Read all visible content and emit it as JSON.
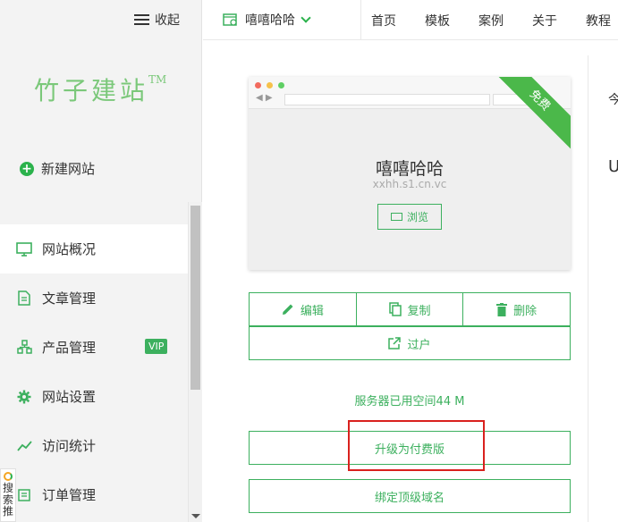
{
  "sidebar": {
    "collapse_label": "收起",
    "logo_text": "竹子建站",
    "logo_tm": "TM",
    "new_site_label": "新建网站",
    "items": [
      {
        "label": "网站概况",
        "icon": "monitor-icon",
        "active": true
      },
      {
        "label": "文章管理",
        "icon": "document-icon"
      },
      {
        "label": "产品管理",
        "icon": "product-icon",
        "badge": "VIP"
      },
      {
        "label": "网站设置",
        "icon": "gear-icon"
      },
      {
        "label": "访问统计",
        "icon": "line-chart-icon"
      },
      {
        "label": "订单管理",
        "icon": "cart-icon"
      }
    ],
    "search_float_label": "搜索推"
  },
  "topbar": {
    "site_name": "嘻嘻哈哈",
    "nav": [
      "首页",
      "模板",
      "案例",
      "关于",
      "教程"
    ]
  },
  "main": {
    "site_title": "嘻嘻哈哈",
    "site_domain": "xxhh.s1.cn.vc",
    "ribbon": "免费",
    "browse_label": "浏览",
    "edit_label": "编辑",
    "copy_label": "复制",
    "delete_label": "删除",
    "transfer_label": "过户",
    "server_space": "服务器已用空间44 M",
    "upgrade_label": "升级为付费版",
    "bind_domain_label": "绑定顶级域名"
  },
  "right": {
    "text1": "今",
    "text2": "U"
  },
  "colors": {
    "accent": "#3cb05e",
    "highlight": "#d9211e",
    "sidebar_bg": "#f3f3f3"
  }
}
